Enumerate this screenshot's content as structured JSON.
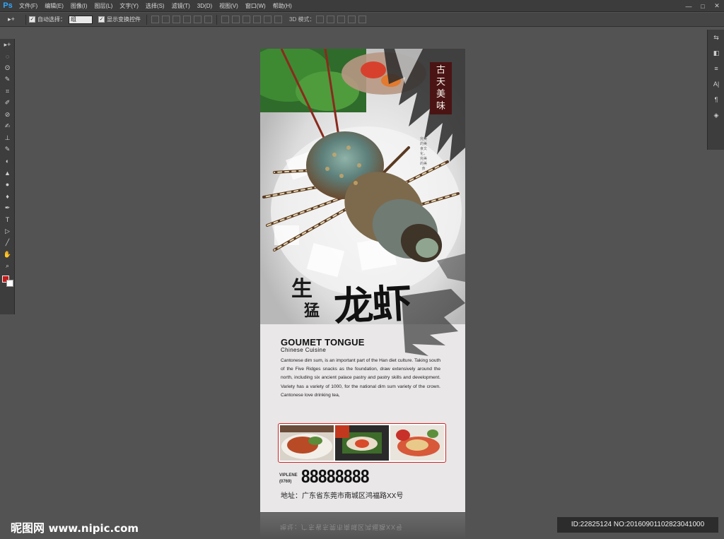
{
  "app": {
    "logo": "Ps"
  },
  "menu": [
    "文件(F)",
    "编辑(E)",
    "图像(I)",
    "图层(L)",
    "文字(Y)",
    "选择(S)",
    "滤镜(T)",
    "3D(D)",
    "视图(V)",
    "窗口(W)",
    "帮助(H)"
  ],
  "window_controls": {
    "minimize": "—",
    "maximize": "□",
    "close": "✕"
  },
  "options": {
    "tool_glyph": "▸+",
    "auto_select_label": "自动选择：",
    "auto_select_value": "组",
    "show_transform_label": "显示变换控件",
    "mode_3d_label": "3D 模式："
  },
  "tools": [
    "▸+",
    "◌",
    "ʘ",
    "✎",
    "⌗",
    "✐",
    "⊘",
    "✍",
    "⊥",
    "✎",
    "◐",
    "▲",
    "●",
    "♦",
    "✒",
    "T",
    "▷",
    "╱",
    "✋",
    "⌕"
  ],
  "right_panel": [
    "⇆",
    "◧",
    "≡",
    "A|",
    "¶",
    "◈"
  ],
  "poster": {
    "seal_chars": [
      "古",
      "天",
      "美",
      "味"
    ],
    "vertical_text": "完美的美食文化，完美的美食",
    "title_small_1": "生",
    "title_small_2": "猛",
    "title_big": "龙虾",
    "en_title": "GOUMET TONGUE",
    "en_subtitle": "Chinese  Cuisine",
    "body": "Cantonese dim sum, is an important part of the Han diet culture. Taking south of the Five Ridges snacks as the foundation, draw extensively around the north, including six ancient palace pastry and pastry skills and development. Variety has a variety of 1000, for the national dim sum variety of the crown. Cantonese love drinking tea,",
    "vip_label_1": "VIPLENE",
    "vip_label_2": "(0769)",
    "phone": "88888888",
    "address": "地址：广东省东莞市南城区鸿福路XX号",
    "reflection": "地址：广东省东莞市南城区鸿福路XX号"
  },
  "watermark": {
    "logo_prefix": "昵图网",
    "logo_url": "www.nipic.com",
    "id_text": "ID:22825124 NO:20160901102823041000"
  },
  "colors": {
    "accent": "#c41a1a",
    "seal": "#4b1414",
    "chrome": "#535353"
  }
}
